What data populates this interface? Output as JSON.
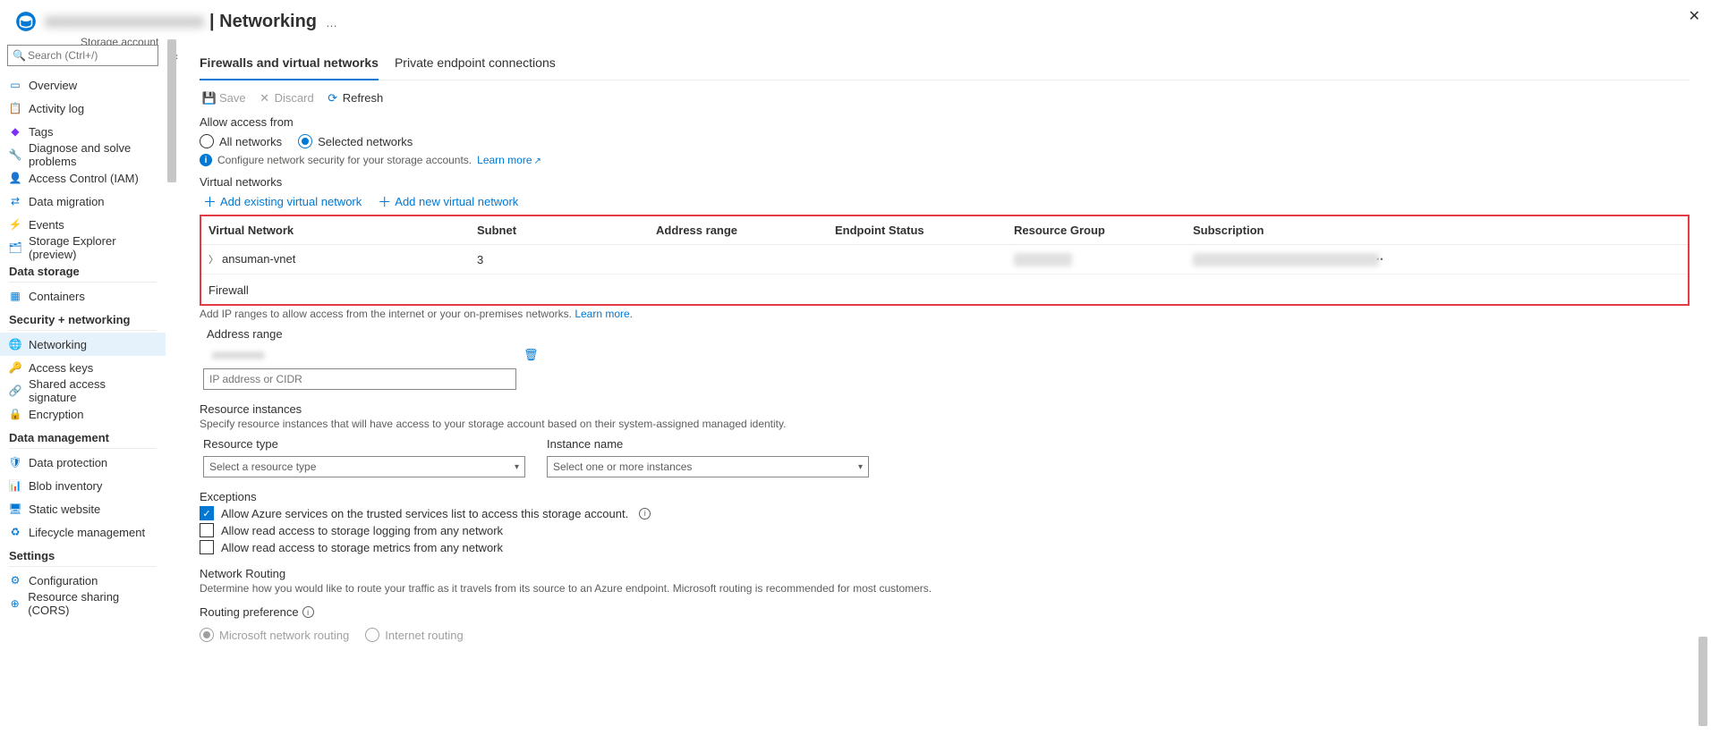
{
  "header": {
    "redacted_name": "xxxxxxxxxxxxxxxx",
    "title_suffix": "| Networking",
    "subtitle": "Storage account",
    "more_icon_label": "…"
  },
  "search": {
    "placeholder": "Search (Ctrl+/)"
  },
  "sidebar": {
    "items_top": [
      {
        "label": "Overview",
        "icon_color": "#0078d4"
      },
      {
        "label": "Activity log",
        "icon_color": "#0078d4"
      },
      {
        "label": "Tags",
        "icon_color": "#7b2ff7"
      },
      {
        "label": "Diagnose and solve problems",
        "icon_color": "#323130"
      },
      {
        "label": "Access Control (IAM)",
        "icon_color": "#0078d4"
      },
      {
        "label": "Data migration",
        "icon_color": "#0078d4"
      },
      {
        "label": "Events",
        "icon_color": "#ffb900"
      },
      {
        "label": "Storage Explorer (preview)",
        "icon_color": "#0078d4"
      }
    ],
    "group_data_storage": {
      "heading": "Data storage",
      "items": [
        {
          "label": "Containers",
          "icon_color": "#0078d4"
        }
      ]
    },
    "group_security": {
      "heading": "Security + networking",
      "items": [
        {
          "label": "Networking",
          "icon_color": "#0078d4",
          "selected": true
        },
        {
          "label": "Access keys",
          "icon_color": "#ffb900"
        },
        {
          "label": "Shared access signature",
          "icon_color": "#0078d4"
        },
        {
          "label": "Encryption",
          "icon_color": "#0078d4"
        }
      ]
    },
    "group_data_mgmt": {
      "heading": "Data management",
      "items": [
        {
          "label": "Data protection",
          "icon_color": "#0078d4"
        },
        {
          "label": "Blob inventory",
          "icon_color": "#0078d4"
        },
        {
          "label": "Static website",
          "icon_color": "#0078d4"
        },
        {
          "label": "Lifecycle management",
          "icon_color": "#0078d4"
        }
      ]
    },
    "group_settings": {
      "heading": "Settings",
      "items": [
        {
          "label": "Configuration",
          "icon_color": "#0078d4"
        },
        {
          "label": "Resource sharing (CORS)",
          "icon_color": "#0078d4"
        }
      ]
    }
  },
  "tabs": {
    "firewalls": "Firewalls and virtual networks",
    "private": "Private endpoint connections"
  },
  "toolbar": {
    "save": "Save",
    "discard": "Discard",
    "refresh": "Refresh"
  },
  "access": {
    "label": "Allow access from",
    "opt_all": "All networks",
    "opt_selected": "Selected networks",
    "info": "Configure network security for your storage accounts.",
    "learn_more": "Learn more"
  },
  "vnet": {
    "heading": "Virtual networks",
    "add_existing": "Add existing virtual network",
    "add_new": "Add new virtual network",
    "cols": {
      "vn": "Virtual Network",
      "subnet": "Subnet",
      "range": "Address range",
      "endpoint": "Endpoint Status",
      "rg": "Resource Group",
      "sub": "Subscription"
    },
    "row": {
      "name": "ansuman-vnet",
      "subnet": "3",
      "rg_redacted": "xxxxxxxxxx",
      "sub_redacted": "xxxxxxxxxxxxxxxxxxxxxxxxxxxxxxxx"
    }
  },
  "firewall": {
    "heading": "Firewall",
    "help": "Add IP ranges to allow access from the internet or your on-premises networks.",
    "learn_more": "Learn more.",
    "address_range_label": "Address range",
    "existing_redacted": "xxxxxxxxx",
    "placeholder": "IP address or CIDR"
  },
  "resource_instances": {
    "heading": "Resource instances",
    "help": "Specify resource instances that will have access to your storage account based on their system-assigned managed identity.",
    "resource_type_label": "Resource type",
    "instance_name_label": "Instance name",
    "resource_type_placeholder": "Select a resource type",
    "instance_placeholder": "Select one or more instances"
  },
  "exceptions": {
    "heading": "Exceptions",
    "opt1": "Allow Azure services on the trusted services list to access this storage account.",
    "opt2": "Allow read access to storage logging from any network",
    "opt3": "Allow read access to storage metrics from any network"
  },
  "routing": {
    "heading": "Network Routing",
    "help": "Determine how you would like to route your traffic as it travels from its source to an Azure endpoint. Microsoft routing is recommended for most customers.",
    "pref_label": "Routing preference",
    "opt_ms": "Microsoft network routing",
    "opt_inet": "Internet routing"
  }
}
